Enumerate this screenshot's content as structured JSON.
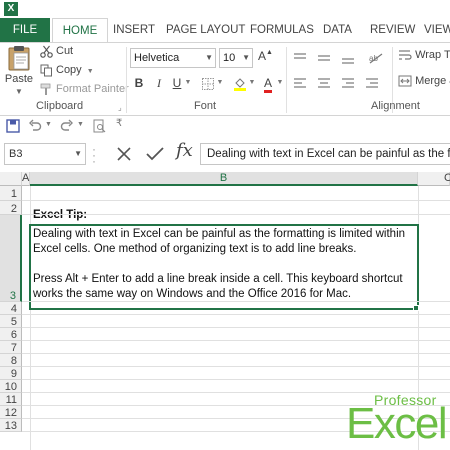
{
  "app": {
    "icon_letter": "X",
    "accent": "#217346",
    "logo_color": "#6cbe45"
  },
  "tabs": [
    "FILE",
    "HOME",
    "INSERT",
    "PAGE LAYOUT",
    "FORMULAS",
    "DATA",
    "REVIEW",
    "VIEW"
  ],
  "ribbon": {
    "clipboard": {
      "paste": "Paste",
      "cut": "Cut",
      "copy": "Copy",
      "format_painter": "Format Painter",
      "group": "Clipboard"
    },
    "font": {
      "name": "Helvetica",
      "size": "10",
      "bold": "B",
      "italic": "I",
      "underline": "U",
      "font_color_letter": "A",
      "grow_letter": "A",
      "shrink_letter": "A",
      "group": "Font"
    },
    "alignment": {
      "wrap": "Wrap Te",
      "merge": "Merge &",
      "group": "Alignment"
    }
  },
  "formula_bar": {
    "name_box": "B3",
    "fx": "fx",
    "content": "Dealing with text in Excel can be painful as the fo"
  },
  "sheet": {
    "columns": [
      "A",
      "B",
      "C"
    ],
    "rows": [
      "1",
      "2",
      "3",
      "4",
      "5",
      "6",
      "7",
      "8",
      "9",
      "10",
      "11",
      "12",
      "13"
    ],
    "tip_title": "Excel Tip:",
    "b3_paragraph_1": "Dealing with text in Excel can be painful as the formatting is limited within Excel cells. One method of organizing text is to add line breaks.",
    "b3_paragraph_2": "Press Alt + Enter to add a line break inside a cell. This keyboard shortcut works the same way on Windows and the Office 2016 for Mac."
  },
  "logo": {
    "small": "Professor",
    "big": "Excel"
  }
}
